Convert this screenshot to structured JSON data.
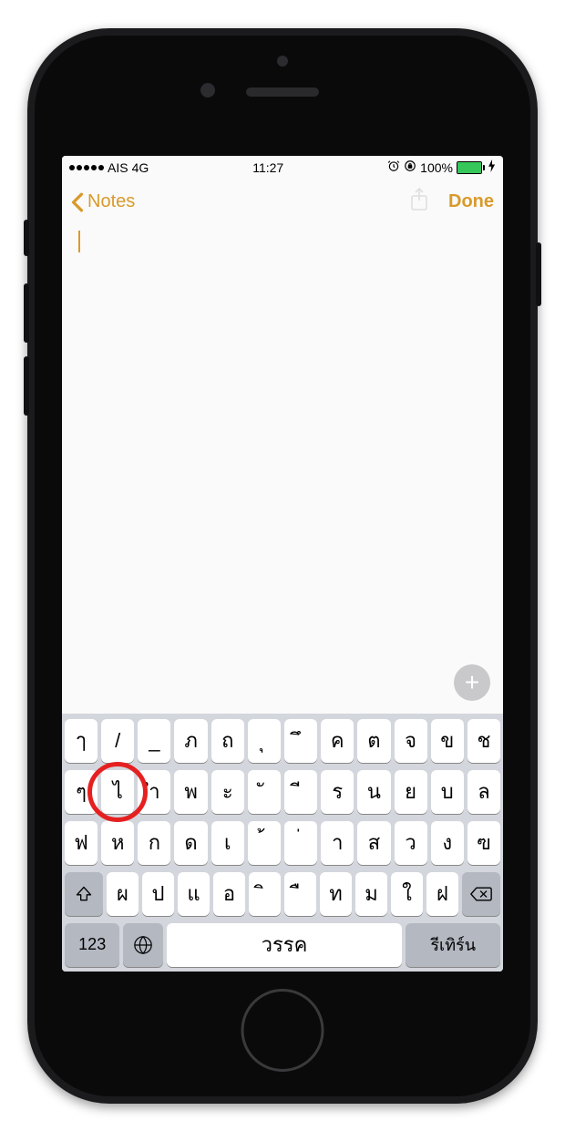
{
  "status": {
    "carrier": "AIS",
    "network": "4G",
    "time": "11:27",
    "battery_pct": "100%"
  },
  "nav": {
    "back_label": "Notes",
    "done_label": "Done"
  },
  "keyboard": {
    "row1": [
      "ๅ",
      "/",
      "_",
      "ภ",
      "ถ",
      "ุ",
      "ึ",
      "ค",
      "ต",
      "จ",
      "ข",
      "ช"
    ],
    "row2": [
      "ๆ",
      "ไ",
      "ำ",
      "พ",
      "ะ",
      "ั",
      "ี",
      "ร",
      "น",
      "ย",
      "บ",
      "ล"
    ],
    "row3": [
      "ฟ",
      "ห",
      "ก",
      "ด",
      "เ",
      "้",
      "่",
      "า",
      "ส",
      "ว",
      "ง",
      "ฃ"
    ],
    "row4": [
      "ผ",
      "ป",
      "แ",
      "อ",
      "ิ",
      "ื",
      "ท",
      "ม",
      "ใ",
      "ฝ"
    ],
    "num_label": "123",
    "space_label": "วรรค",
    "return_label": "รีเทิร์น"
  },
  "annotation": {
    "highlighted_key_index": 1
  }
}
